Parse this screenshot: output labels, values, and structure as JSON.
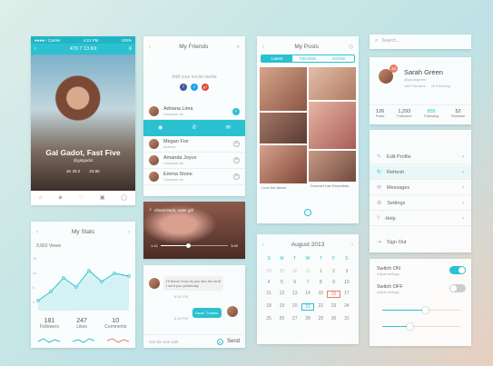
{
  "profile": {
    "status_left": "●●●●○ Carrier",
    "status_time": "4:21 PM",
    "status_right": "100%",
    "title": "470 7 13 Kit",
    "name": "Gal Gadot, Fast Five",
    "subtitle": "@galgadot",
    "meta_left": "1K 29.2",
    "meta_right": "23.6K"
  },
  "stats": {
    "title": "My Stats",
    "total_label": "9,862 Views",
    "items": [
      {
        "value": "181",
        "label": "Followers"
      },
      {
        "value": "247",
        "label": "Likes"
      },
      {
        "value": "10",
        "label": "Comments"
      }
    ],
    "y_labels": [
      "15",
      "10",
      "5",
      "0"
    ]
  },
  "friends": {
    "title": "My Friends",
    "hint": "Add your social media",
    "social": [
      "f",
      "t",
      "g+"
    ],
    "people": [
      {
        "name": "Adriana Lima",
        "sub": "Compare all"
      },
      {
        "name": "Megan Fox",
        "sub": "Actress"
      },
      {
        "name": "Amanda Joyce",
        "sub": "Compare all"
      },
      {
        "name": "Emma Stone",
        "sub": "Compare all"
      }
    ]
  },
  "music": {
    "caption": "Ghost track, outer girl",
    "time_start": "1:12",
    "time_end": "3:40"
  },
  "chat": {
    "msg1": "Hi there! How do you like the stuff I sent you yesterday",
    "msg1_time": "8:26 PM",
    "msg2": "Good. Thanks",
    "msg2_time": "8:28 PM",
    "placeholder": "Get the text with",
    "send": "Send"
  },
  "posts": {
    "title": "My Posts",
    "tabs": [
      "Latest",
      "Favorites",
      "Archive"
    ],
    "captions": [
      "Love the island",
      "Summer hair Essentials"
    ]
  },
  "calendar": {
    "title": "August 2013",
    "weekdays": [
      "S",
      "M",
      "T",
      "W",
      "T",
      "F",
      "S"
    ],
    "days": [
      "28",
      "29",
      "30",
      "31",
      "1",
      "2",
      "3",
      "4",
      "5",
      "6",
      "7",
      "8",
      "9",
      "10",
      "11",
      "12",
      "13",
      "14",
      "15",
      "16",
      "17",
      "18",
      "19",
      "20",
      "21",
      "22",
      "23",
      "24",
      "25",
      "26",
      "27",
      "28",
      "29",
      "30",
      "31"
    ]
  },
  "search": {
    "placeholder": "Search..."
  },
  "user": {
    "name": "Sarah Green",
    "handle": "@sarahgreen",
    "badge": "12",
    "mini": [
      "136 Followers",
      "26 Following"
    ],
    "stats": [
      {
        "value": "126",
        "label": "Posts"
      },
      {
        "value": "1,293",
        "label": "Followers"
      },
      {
        "value": "855",
        "label": "Following"
      },
      {
        "value": "52",
        "label": "Rewards"
      }
    ]
  },
  "menu": {
    "items": [
      "Edit Profile",
      "Refresh",
      "Messages",
      "Settings",
      "Help"
    ],
    "signout": "Sign Out"
  },
  "switches": {
    "on_label": "Switch ON",
    "off_label": "Switch OFF",
    "on_sub": "Adjust settings",
    "off_sub": "Adjust settings",
    "slider1_level": 0.55,
    "slider2_level": 0.35
  },
  "colors": {
    "accent": "#2bc1d1",
    "highlight": "#e57f6b"
  }
}
